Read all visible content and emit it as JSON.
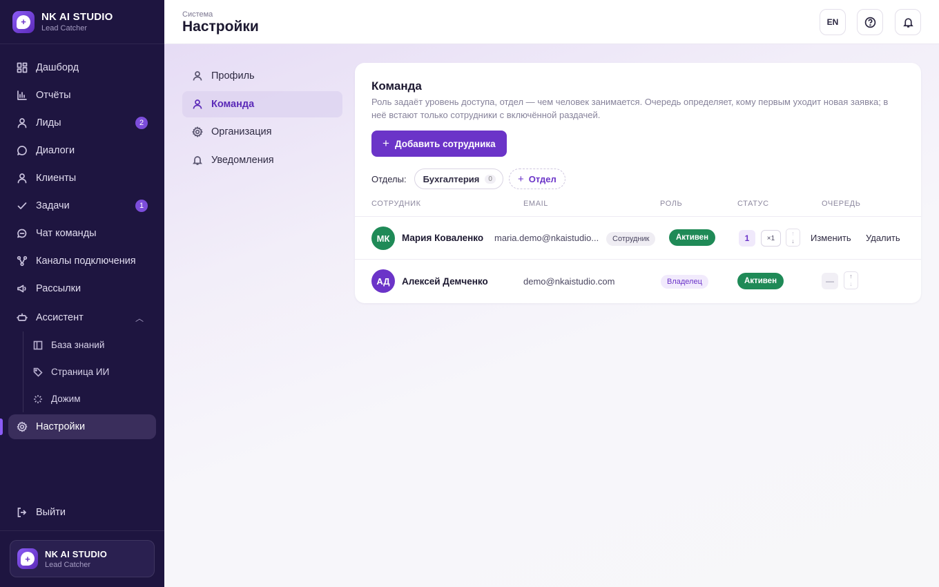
{
  "brand": {
    "name": "NK AI STUDIO",
    "subtitle": "Lead Catcher"
  },
  "sidebar": {
    "items": [
      {
        "label": "Дашборд",
        "icon": "dashboard-icon"
      },
      {
        "label": "Отчёты",
        "icon": "bar-chart-icon"
      },
      {
        "label": "Лиды",
        "icon": "user-icon",
        "badge": "2"
      },
      {
        "label": "Диалоги",
        "icon": "chat-bubble-icon"
      },
      {
        "label": "Клиенты",
        "icon": "user-icon"
      },
      {
        "label": "Задачи",
        "icon": "check-icon",
        "badge": "1"
      },
      {
        "label": "Чат команды",
        "icon": "team-chat-icon"
      },
      {
        "label": "Каналы подключения",
        "icon": "channels-icon"
      },
      {
        "label": "Рассылки",
        "icon": "megaphone-icon"
      },
      {
        "label": "Ассистент",
        "icon": "robot-icon"
      }
    ],
    "assistant_sub": [
      {
        "label": "База знаний",
        "icon": "book-icon"
      },
      {
        "label": "Страница ИИ",
        "icon": "tag-icon"
      },
      {
        "label": "Дожим",
        "icon": "spinner-icon"
      }
    ],
    "active": {
      "label": "Настройки",
      "icon": "gear-icon"
    },
    "logout": "Выйти"
  },
  "header": {
    "breadcrumb": "Система",
    "title": "Настройки",
    "lang": "EN"
  },
  "settings_nav": [
    {
      "label": "Профиль",
      "icon": "user-icon"
    },
    {
      "label": "Команда",
      "icon": "user-icon",
      "active": true
    },
    {
      "label": "Организация",
      "icon": "gear-icon"
    },
    {
      "label": "Уведомления",
      "icon": "bell-icon"
    }
  ],
  "team": {
    "title": "Команда",
    "description": "Роль задаёт уровень доступа, отдел — чем человек занимается. Очередь определяет, кому первым уходит новая заявка; в неё встают только сотрудники с включённой раздачей.",
    "add_button": "Добавить сотрудника",
    "departments_label": "Отделы:",
    "departments": [
      {
        "name": "Бухгалтерия",
        "count": "0"
      }
    ],
    "add_department": "Отдел",
    "columns": [
      "СОТРУДНИК",
      "EMAIL",
      "РОЛЬ",
      "СТАТУС",
      "ОЧЕРЕДЬ"
    ],
    "rows": [
      {
        "initials": "МК",
        "name": "Мария Коваленко",
        "email": "maria.demo@nkaistudio...",
        "role": "Сотрудник",
        "status": "Активен",
        "queue_pos": "1",
        "queue_mult": "×1",
        "edit": "Изменить",
        "delete": "Удалить"
      },
      {
        "initials": "АД",
        "name": "Алексей Демченко",
        "email": "demo@nkaistudio.com",
        "role": "Владелец",
        "status": "Активен",
        "queue_pos": "—"
      }
    ]
  },
  "colors": {
    "sidebar_bg": "#1e1540",
    "accent": "#6b34c8",
    "status_active": "#1f8a57",
    "avatar_mk": "#1f8a57",
    "avatar_ad": "#6b34c8"
  }
}
